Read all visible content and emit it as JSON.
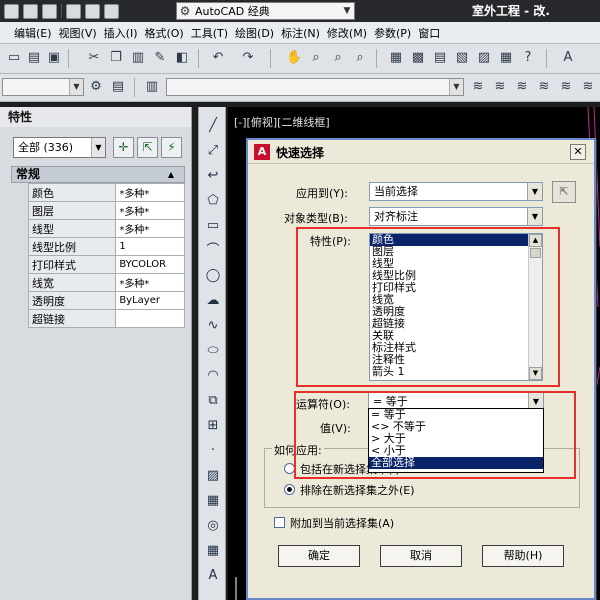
{
  "titlebar": {
    "workspace": "AutoCAD 经典",
    "app_title": "室外工程 - 改."
  },
  "menu": [
    "编辑(E)",
    "视图(V)",
    "插入(I)",
    "格式(O)",
    "工具(T)",
    "绘图(D)",
    "标注(N)",
    "修改(M)",
    "参数(P)",
    "窗口"
  ],
  "properties": {
    "title": "特性",
    "selection": "全部 (336)",
    "category": "常规",
    "rows": [
      {
        "name": "颜色",
        "value": "*多种*"
      },
      {
        "name": "图层",
        "value": "*多种*"
      },
      {
        "name": "线型",
        "value": "*多种*"
      },
      {
        "name": "线型比例",
        "value": "1"
      },
      {
        "name": "打印样式",
        "value": "BYCOLOR"
      },
      {
        "name": "线宽",
        "value": "*多种*"
      },
      {
        "name": "透明度",
        "value": "ByLayer"
      },
      {
        "name": "超链接",
        "value": ""
      }
    ]
  },
  "viewport_label": "[-][俯视][二维线框]",
  "dialog": {
    "title": "快速选择",
    "apply_to_label": "应用到(Y):",
    "apply_to_value": "当前选择",
    "object_type_label": "对象类型(B):",
    "object_type_value": "对齐标注",
    "properties_label": "特性(P):",
    "properties_list": [
      "颜色",
      "图层",
      "线型",
      "线型比例",
      "打印样式",
      "线宽",
      "透明度",
      "超链接",
      "关联",
      "标注样式",
      "注释性",
      "箭头 1"
    ],
    "properties_selected": 0,
    "operator_label": "运算符(O):",
    "operator_value": "= 等于",
    "operator_options": [
      "= 等于",
      "<> 不等于",
      "> 大于",
      "< 小于",
      "全部选择"
    ],
    "operator_selected": 4,
    "value_label": "值(V):",
    "how_to_apply_label": "如何应用:",
    "include_label": "包括在新选择集中(I)",
    "exclude_label": "排除在新选择集之外(E)",
    "append_label": "附加到当前选择集(A)",
    "ok_label": "确定",
    "cancel_label": "取消",
    "help_label": "帮助(H)"
  },
  "colors": {
    "highlight": "#0a246a",
    "annotation_red": "#e8302a",
    "canvas": "#000000",
    "dialog_bg": "#ece9d8"
  }
}
